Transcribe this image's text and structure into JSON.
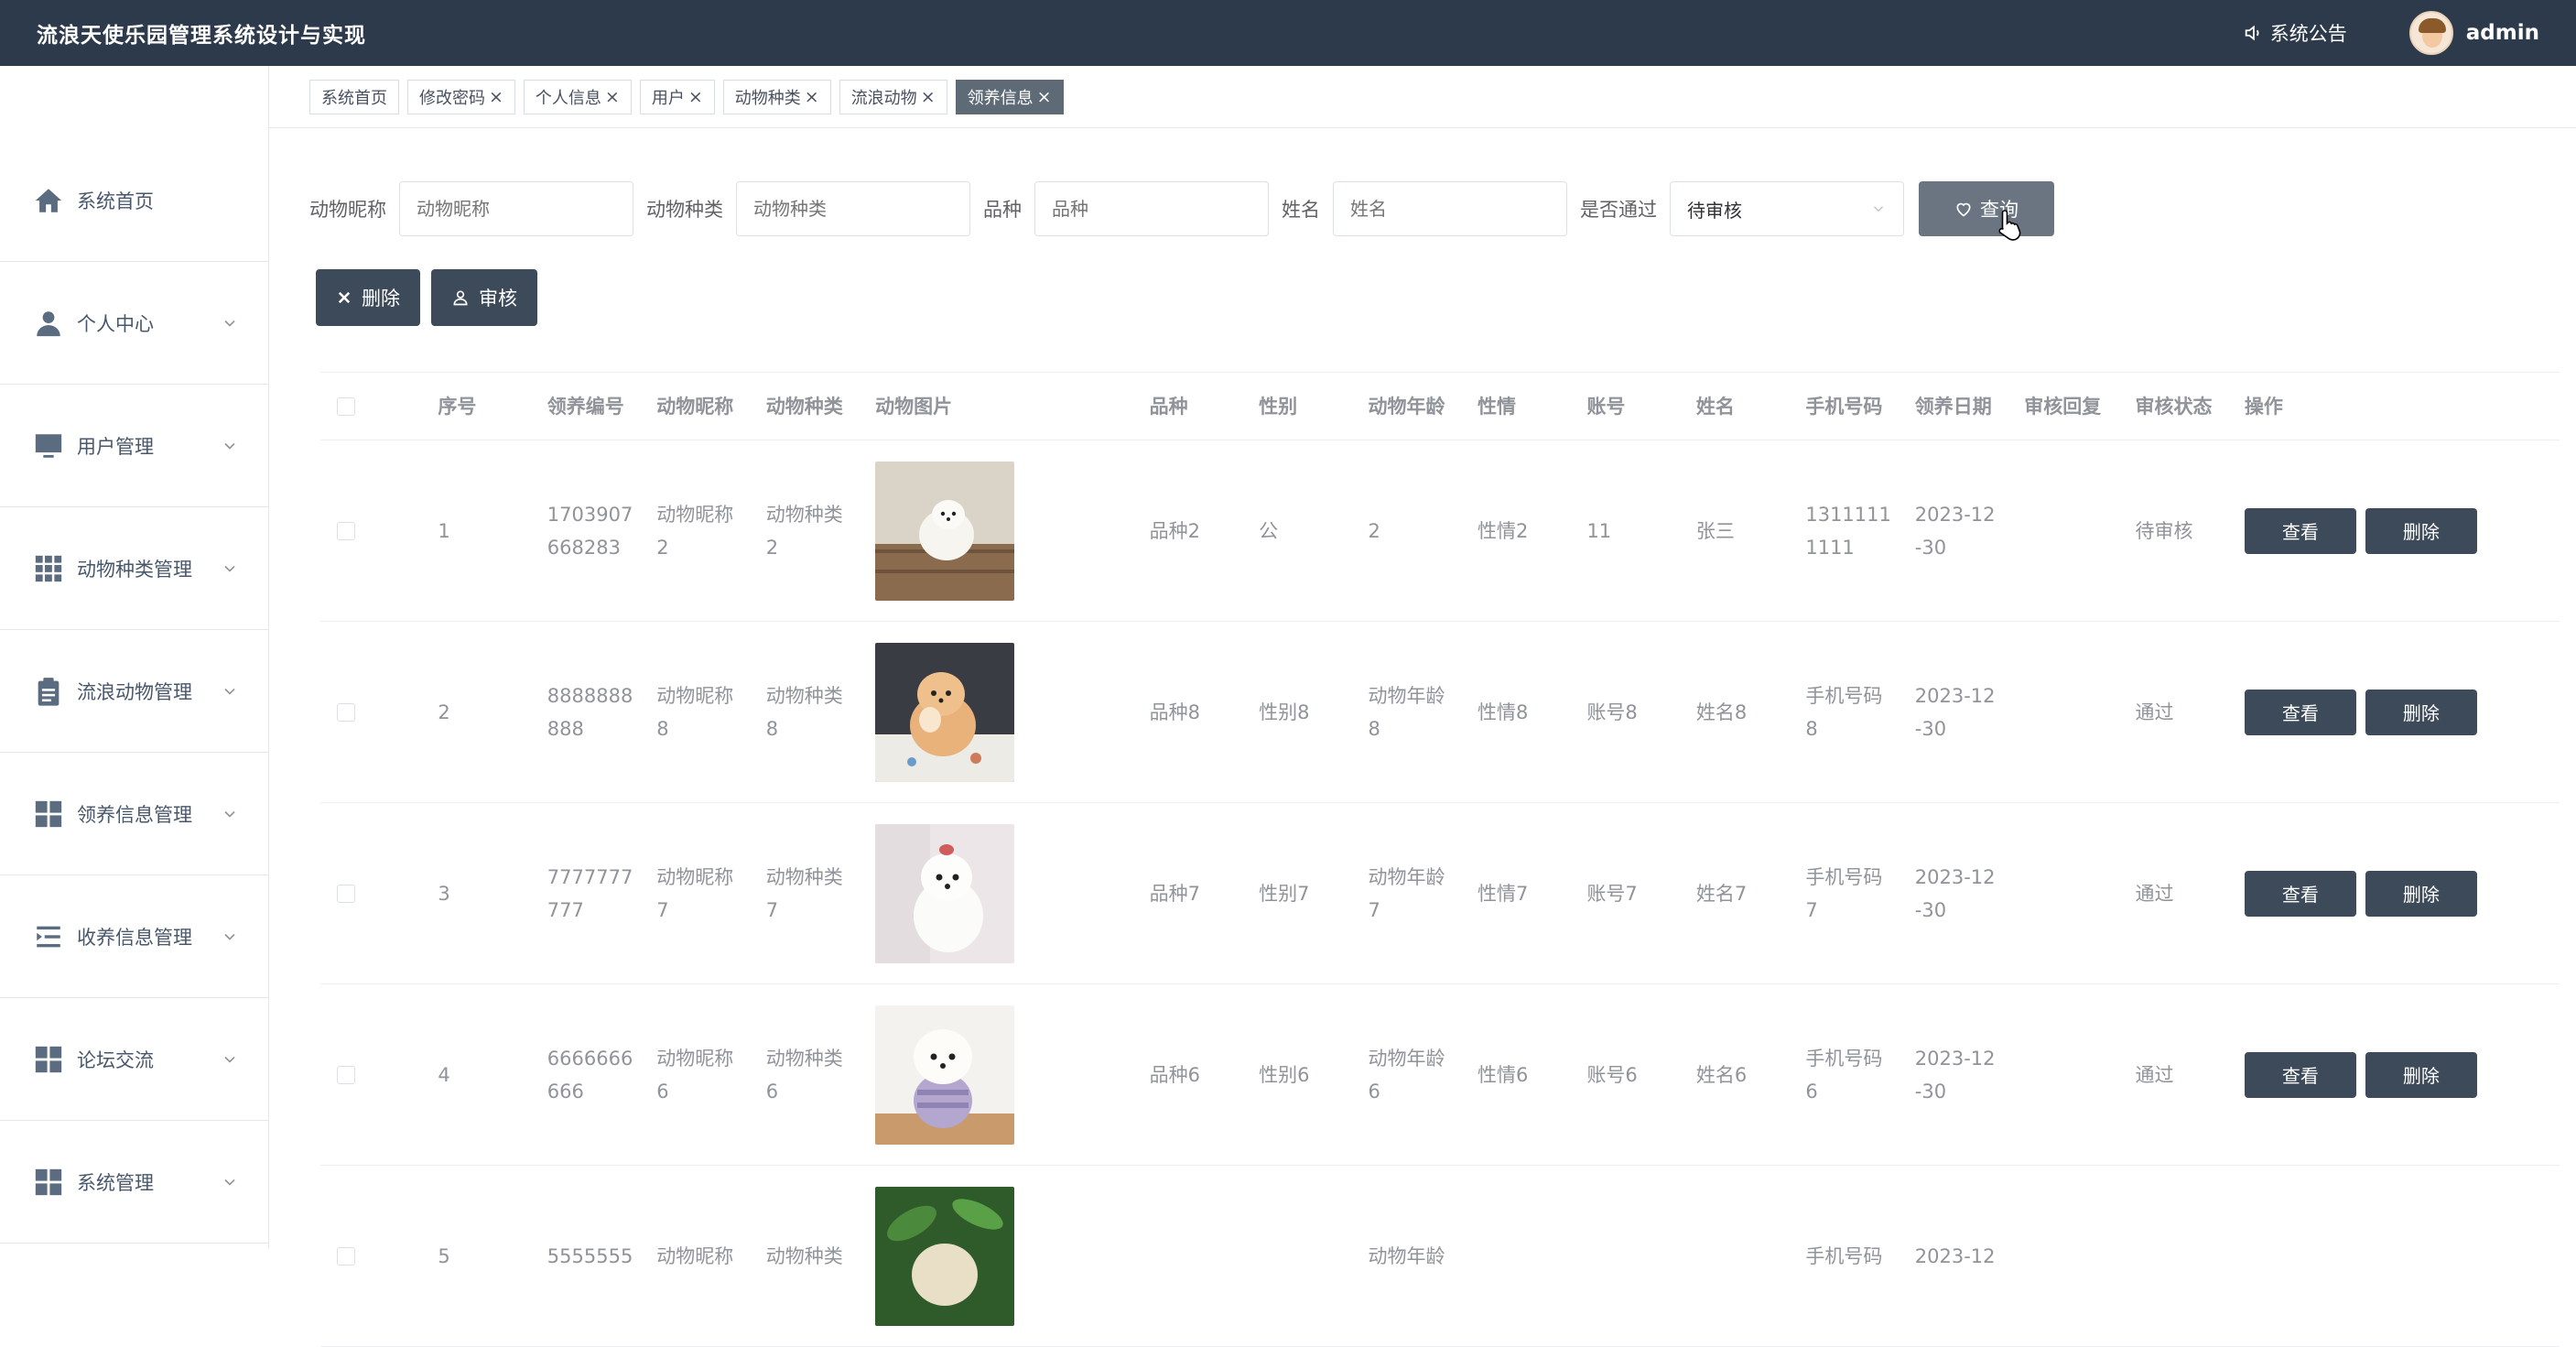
{
  "header": {
    "title": "流浪天使乐园管理系统设计与实现",
    "notice_label": "系统公告",
    "user_name": "admin"
  },
  "sidebar": {
    "items": [
      {
        "label": "系统首页",
        "icon": "home-icon"
      },
      {
        "label": "个人中心",
        "icon": "user-icon"
      },
      {
        "label": "用户管理",
        "icon": "monitor-icon"
      },
      {
        "label": "动物种类管理",
        "icon": "grid-icon"
      },
      {
        "label": "流浪动物管理",
        "icon": "clipboard-icon"
      },
      {
        "label": "领养信息管理",
        "icon": "apps-icon"
      },
      {
        "label": "收养信息管理",
        "icon": "list-indent-icon"
      },
      {
        "label": "论坛交流",
        "icon": "apps-icon"
      },
      {
        "label": "系统管理",
        "icon": "apps-icon"
      }
    ]
  },
  "tabs": [
    {
      "label": "系统首页",
      "closable": false,
      "active": false
    },
    {
      "label": "修改密码",
      "closable": true,
      "active": false
    },
    {
      "label": "个人信息",
      "closable": true,
      "active": false
    },
    {
      "label": "用户",
      "closable": true,
      "active": false
    },
    {
      "label": "动物种类",
      "closable": true,
      "active": false
    },
    {
      "label": "流浪动物",
      "closable": true,
      "active": false
    },
    {
      "label": "领养信息",
      "closable": true,
      "active": true
    }
  ],
  "search": {
    "nickname_label": "动物昵称",
    "nickname_placeholder": "动物昵称",
    "kind_label": "动物种类",
    "kind_placeholder": "动物种类",
    "breed_label": "品种",
    "breed_placeholder": "品种",
    "name_label": "姓名",
    "name_placeholder": "姓名",
    "pass_label": "是否通过",
    "pass_value": "待审核",
    "query_button": "查询"
  },
  "actions": {
    "delete_button": "删除",
    "review_button": "审核"
  },
  "table": {
    "headers": [
      "序号",
      "领养编号",
      "动物昵称",
      "动物种类",
      "动物图片",
      "品种",
      "性别",
      "动物年龄",
      "性情",
      "账号",
      "姓名",
      "手机号码",
      "领养日期",
      "审核回复",
      "审核状态",
      "操作"
    ],
    "view_button": "查看",
    "delete_button": "删除",
    "rows": [
      {
        "no": "1",
        "code": [
          "1703907",
          "668283"
        ],
        "nick": [
          "动物昵称",
          "2"
        ],
        "kind": [
          "动物种类",
          "2"
        ],
        "breed": "品种2",
        "sex": "公",
        "age": [
          "2",
          ""
        ],
        "temper": "性情2",
        "account": "11",
        "name": "张三",
        "phone": [
          "1311111",
          "1111"
        ],
        "date": [
          "2023-12",
          "-30"
        ],
        "reply": "",
        "status": "待审核",
        "pet": "white-pomeranian"
      },
      {
        "no": "2",
        "code": [
          "8888888",
          "888"
        ],
        "nick": [
          "动物昵称",
          "8"
        ],
        "kind": [
          "动物种类",
          "8"
        ],
        "breed": "品种8",
        "sex": "性别8",
        "age": [
          "动物年龄",
          "8"
        ],
        "temper": "性情8",
        "account": "账号8",
        "name": "姓名8",
        "phone": [
          "手机号码",
          "8"
        ],
        "date": [
          "2023-12",
          "-30"
        ],
        "reply": "",
        "status": "通过",
        "pet": "orange-pomeranian"
      },
      {
        "no": "3",
        "code": [
          "7777777",
          "777"
        ],
        "nick": [
          "动物昵称",
          "7"
        ],
        "kind": [
          "动物种类",
          "7"
        ],
        "breed": "品种7",
        "sex": "性别7",
        "age": [
          "动物年龄",
          "7"
        ],
        "temper": "性情7",
        "account": "账号7",
        "name": "姓名7",
        "phone": [
          "手机号码",
          "7"
        ],
        "date": [
          "2023-12",
          "-30"
        ],
        "reply": "",
        "status": "通过",
        "pet": "white-maltese"
      },
      {
        "no": "4",
        "code": [
          "6666666",
          "666"
        ],
        "nick": [
          "动物昵称",
          "6"
        ],
        "kind": [
          "动物种类",
          "6"
        ],
        "breed": "品种6",
        "sex": "性别6",
        "age": [
          "动物年龄",
          "6"
        ],
        "temper": "性情6",
        "account": "账号6",
        "name": "姓名6",
        "phone": [
          "手机号码",
          "6"
        ],
        "date": [
          "2023-12",
          "-30"
        ],
        "reply": "",
        "status": "通过",
        "pet": "bichon-sweater"
      },
      {
        "no": "5",
        "code": [
          "5555555",
          ""
        ],
        "nick": [
          "动物昵称",
          ""
        ],
        "kind": [
          "动物种类",
          ""
        ],
        "breed": "",
        "sex": "",
        "age": [
          "动物年龄",
          ""
        ],
        "temper": "",
        "account": "",
        "name": "",
        "phone": [
          "手机号码",
          ""
        ],
        "date": [
          "2023-12",
          ""
        ],
        "reply": "",
        "status": "",
        "pet": "plant-dog"
      }
    ]
  },
  "colors": {
    "header_bg": "#2d3a4b",
    "button_dark": "#3d4a59",
    "active_tab": "#5f6a77"
  }
}
